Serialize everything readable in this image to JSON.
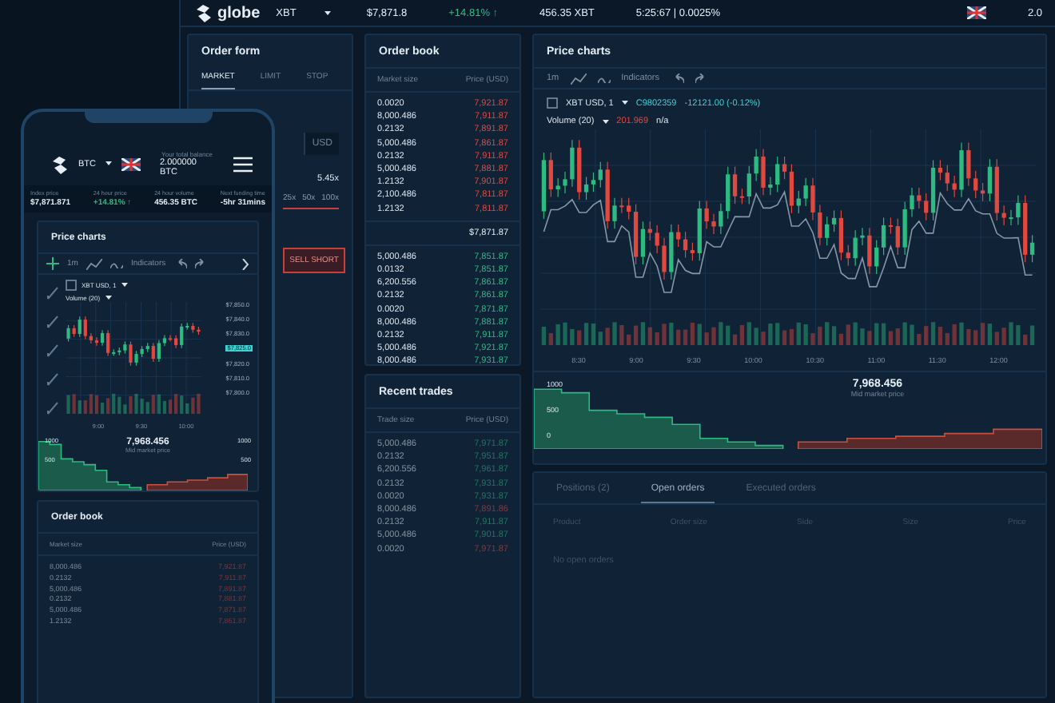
{
  "desktop": {
    "top_bar": {
      "logo": "globe",
      "market": "XBT",
      "stats": [
        {
          "value": "$7,871.8",
          "kind": "plain"
        },
        {
          "value": "+14.81% ↑",
          "kind": "up"
        },
        {
          "value": "456.35 XBT",
          "kind": "plain"
        },
        {
          "value": "5:25:67 | 0.0025%",
          "kind": "plain"
        }
      ],
      "balance": "2.0"
    },
    "order_form": {
      "title": "Order form",
      "tabs": [
        {
          "label": "MARKET",
          "selected": true
        },
        {
          "label": "LIMIT",
          "selected": false
        },
        {
          "label": "STOP",
          "selected": false
        }
      ],
      "currency": "USD",
      "leverage": "5.45x",
      "leverage_options": [
        "25x",
        "50x",
        "100x"
      ],
      "sell_button": "SELL SHORT"
    },
    "order_book": {
      "title": "Order book",
      "columns": [
        "Market size",
        "Price (USD)"
      ],
      "asks": [
        {
          "size": "0.0020",
          "price": "7,921.87"
        },
        {
          "size": "8,000.486",
          "price": "7,911.87"
        },
        {
          "size": "0.2132",
          "price": "7,891.87"
        },
        {
          "size": "5,000.486",
          "price": "7,861.87"
        },
        {
          "size": "0.2132",
          "price": "7,911.87"
        },
        {
          "size": "5,000.486",
          "price": "7,881.87"
        },
        {
          "size": "1.2132",
          "price": "7,901.87"
        },
        {
          "size": "2,100.486",
          "price": "7,811.87"
        },
        {
          "size": "1.2132",
          "price": "7,811.87"
        }
      ],
      "mid_price": "$7,871.87",
      "bids": [
        {
          "size": "5,000.486",
          "price": "7,851.87"
        },
        {
          "size": "0.0132",
          "price": "7,851.87"
        },
        {
          "size": "6,200.556",
          "price": "7,861.87"
        },
        {
          "size": "0.2132",
          "price": "7,861.87"
        },
        {
          "size": "0.0020",
          "price": "7,871.87"
        },
        {
          "size": "8,000.486",
          "price": "7,881.87"
        },
        {
          "size": "0.2132",
          "price": "7,911.87"
        },
        {
          "size": "5,000.486",
          "price": "7,921.87"
        },
        {
          "size": "8,000.486",
          "price": "7,931.87"
        }
      ]
    },
    "recent_trades": {
      "title": "Recent trades",
      "columns": [
        "Trade size",
        "Price (USD)"
      ],
      "rows": [
        {
          "size": "5,000.486",
          "price": "7,971.87",
          "kind": "buy"
        },
        {
          "size": "0.2132",
          "price": "7,951.87",
          "kind": "buy"
        },
        {
          "size": "6,200.556",
          "price": "7,961.87",
          "kind": "buy"
        },
        {
          "size": "0.2132",
          "price": "7,931.87",
          "kind": "buy"
        },
        {
          "size": "0.0020",
          "price": "7,931.87",
          "kind": "buy"
        },
        {
          "size": "8,000.486",
          "price": "7,891.86",
          "kind": "sell"
        },
        {
          "size": "0.2132",
          "price": "7,911.87",
          "kind": "buy"
        },
        {
          "size": "5,000.486",
          "price": "7,901.87",
          "kind": "buy"
        },
        {
          "size": "0.0020",
          "price": "7,971.87",
          "kind": "sell"
        }
      ]
    },
    "price_chart": {
      "title": "Price charts",
      "interval": "1m",
      "indicators": "Indicators",
      "symbol": "XBT USD, 1",
      "close": "C9802359",
      "change": "-12121.00 (-0.12%)",
      "volume": "Volume (20)",
      "volume_value": "201.969",
      "volume_na": "n/a",
      "x_labels": [
        "8:30",
        "9:00",
        "9:30",
        "10:00",
        "10:30",
        "11:00",
        "11:30",
        "12:00"
      ],
      "depth": {
        "y_labels": [
          "1000",
          "500",
          "0"
        ],
        "mid_price": "7,968.456",
        "mid_label": "Mid market price"
      }
    },
    "orders_panel": {
      "tabs": [
        {
          "label": "Positions (2)",
          "selected": false
        },
        {
          "label": "Open orders",
          "selected": true
        },
        {
          "label": "Executed orders",
          "selected": false
        }
      ],
      "columns": [
        "Product",
        "Order size",
        "Side",
        "Size",
        "Price"
      ],
      "empty": "No open orders"
    }
  },
  "phone": {
    "market": "BTC",
    "balance_label": "Your total balance",
    "balance": "2.000000 BTC",
    "stats": [
      {
        "label": "Index price",
        "value": "$7,871.871",
        "kind": "plain"
      },
      {
        "label": "24 hour price",
        "value": "+14.81% ↑",
        "kind": "up"
      },
      {
        "label": "24 hour volume",
        "value": "456.35 BTC",
        "kind": "plain"
      },
      {
        "label": "Next funding time",
        "value": "-5hr 31mins",
        "kind": "plain"
      }
    ],
    "price_chart": {
      "title": "Price charts",
      "interval": "1m",
      "indicators": "Indicators",
      "symbol": "XBT USD, 1",
      "volume": "Volume (20)",
      "y_labels": [
        {
          "text": "$7,850.0",
          "highlighted": false
        },
        {
          "text": "$7,840.0",
          "highlighted": false
        },
        {
          "text": "$7,830.0",
          "highlighted": false
        },
        {
          "text": "$7,825.0",
          "highlighted": true
        },
        {
          "text": "$7,820.0",
          "highlighted": false
        },
        {
          "text": "$7,810.0",
          "highlighted": false
        },
        {
          "text": "$7,800.0",
          "highlighted": false
        }
      ],
      "x_labels": [
        "9:00",
        "9:30",
        "10:00"
      ],
      "depth": {
        "left_labels": [
          "1000",
          "500"
        ],
        "right_labels": [
          "1000",
          "500"
        ],
        "mid_price": "7,968.456",
        "mid_label": "Mid market price"
      }
    },
    "order_book": {
      "title": "Order book",
      "columns": [
        "Market size",
        "Price (USD)"
      ],
      "rows": [
        {
          "size": "8,000.486",
          "price": "7,921.87"
        },
        {
          "size": "0.2132",
          "price": "7,911.87"
        },
        {
          "size": "5,000.486",
          "price": "7,891.87"
        },
        {
          "size": "0.2132",
          "price": "7,881.87"
        },
        {
          "size": "5,000.486",
          "price": "7,871.87"
        },
        {
          "size": "1.2132",
          "price": "7,861.87"
        }
      ]
    }
  }
}
